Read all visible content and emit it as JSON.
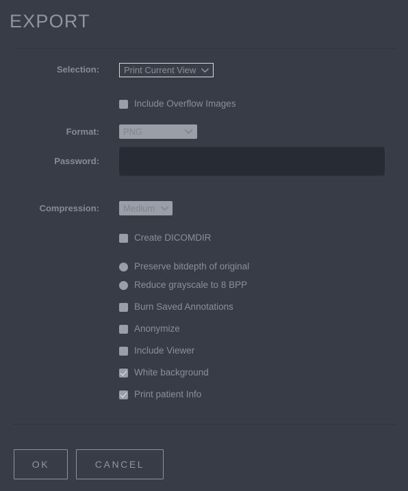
{
  "dialog": {
    "title": "EXPORT"
  },
  "fields": {
    "selection": {
      "label": "Selection:",
      "value": "Print Current View",
      "options": [
        "Print Current View"
      ]
    },
    "format": {
      "label": "Format:",
      "value": "PNG",
      "options": [
        "PNG"
      ],
      "disabled": true
    },
    "password": {
      "label": "Password:",
      "value": "",
      "placeholder": ""
    },
    "compression": {
      "label": "Compression:",
      "value": "Medium",
      "options": [
        "Medium"
      ],
      "disabled": true
    }
  },
  "options": {
    "include_overflow_images": {
      "label": "Include Overflow Images",
      "type": "checkbox",
      "checked": false
    },
    "create_dicomdir": {
      "label": "Create DICOMDIR",
      "type": "checkbox",
      "checked": false
    },
    "preserve_bitdepth": {
      "label": "Preserve bitdepth of original",
      "type": "radio",
      "checked": false
    },
    "reduce_grayscale": {
      "label": "Reduce grayscale to 8 BPP",
      "type": "radio",
      "checked": false
    },
    "burn_annotations": {
      "label": "Burn Saved Annotations",
      "type": "checkbox",
      "checked": false
    },
    "anonymize": {
      "label": "Anonymize",
      "type": "checkbox",
      "checked": false
    },
    "include_viewer": {
      "label": "Include Viewer",
      "type": "checkbox",
      "checked": false
    },
    "white_background": {
      "label": "White background",
      "type": "checkbox",
      "checked": true
    },
    "print_patient_info": {
      "label": "Print patient Info",
      "type": "checkbox",
      "checked": true
    }
  },
  "buttons": {
    "ok": "OK",
    "cancel": "CANCEL"
  },
  "colors": {
    "background": "#373c47",
    "text_muted": "#8a8f9a",
    "text_label": "#868b96",
    "title": "#9095a0",
    "control_disabled": "#9a9ea7",
    "input_background": "#272b34",
    "divider": "#2e323c",
    "border_light": "#d9dce1"
  }
}
